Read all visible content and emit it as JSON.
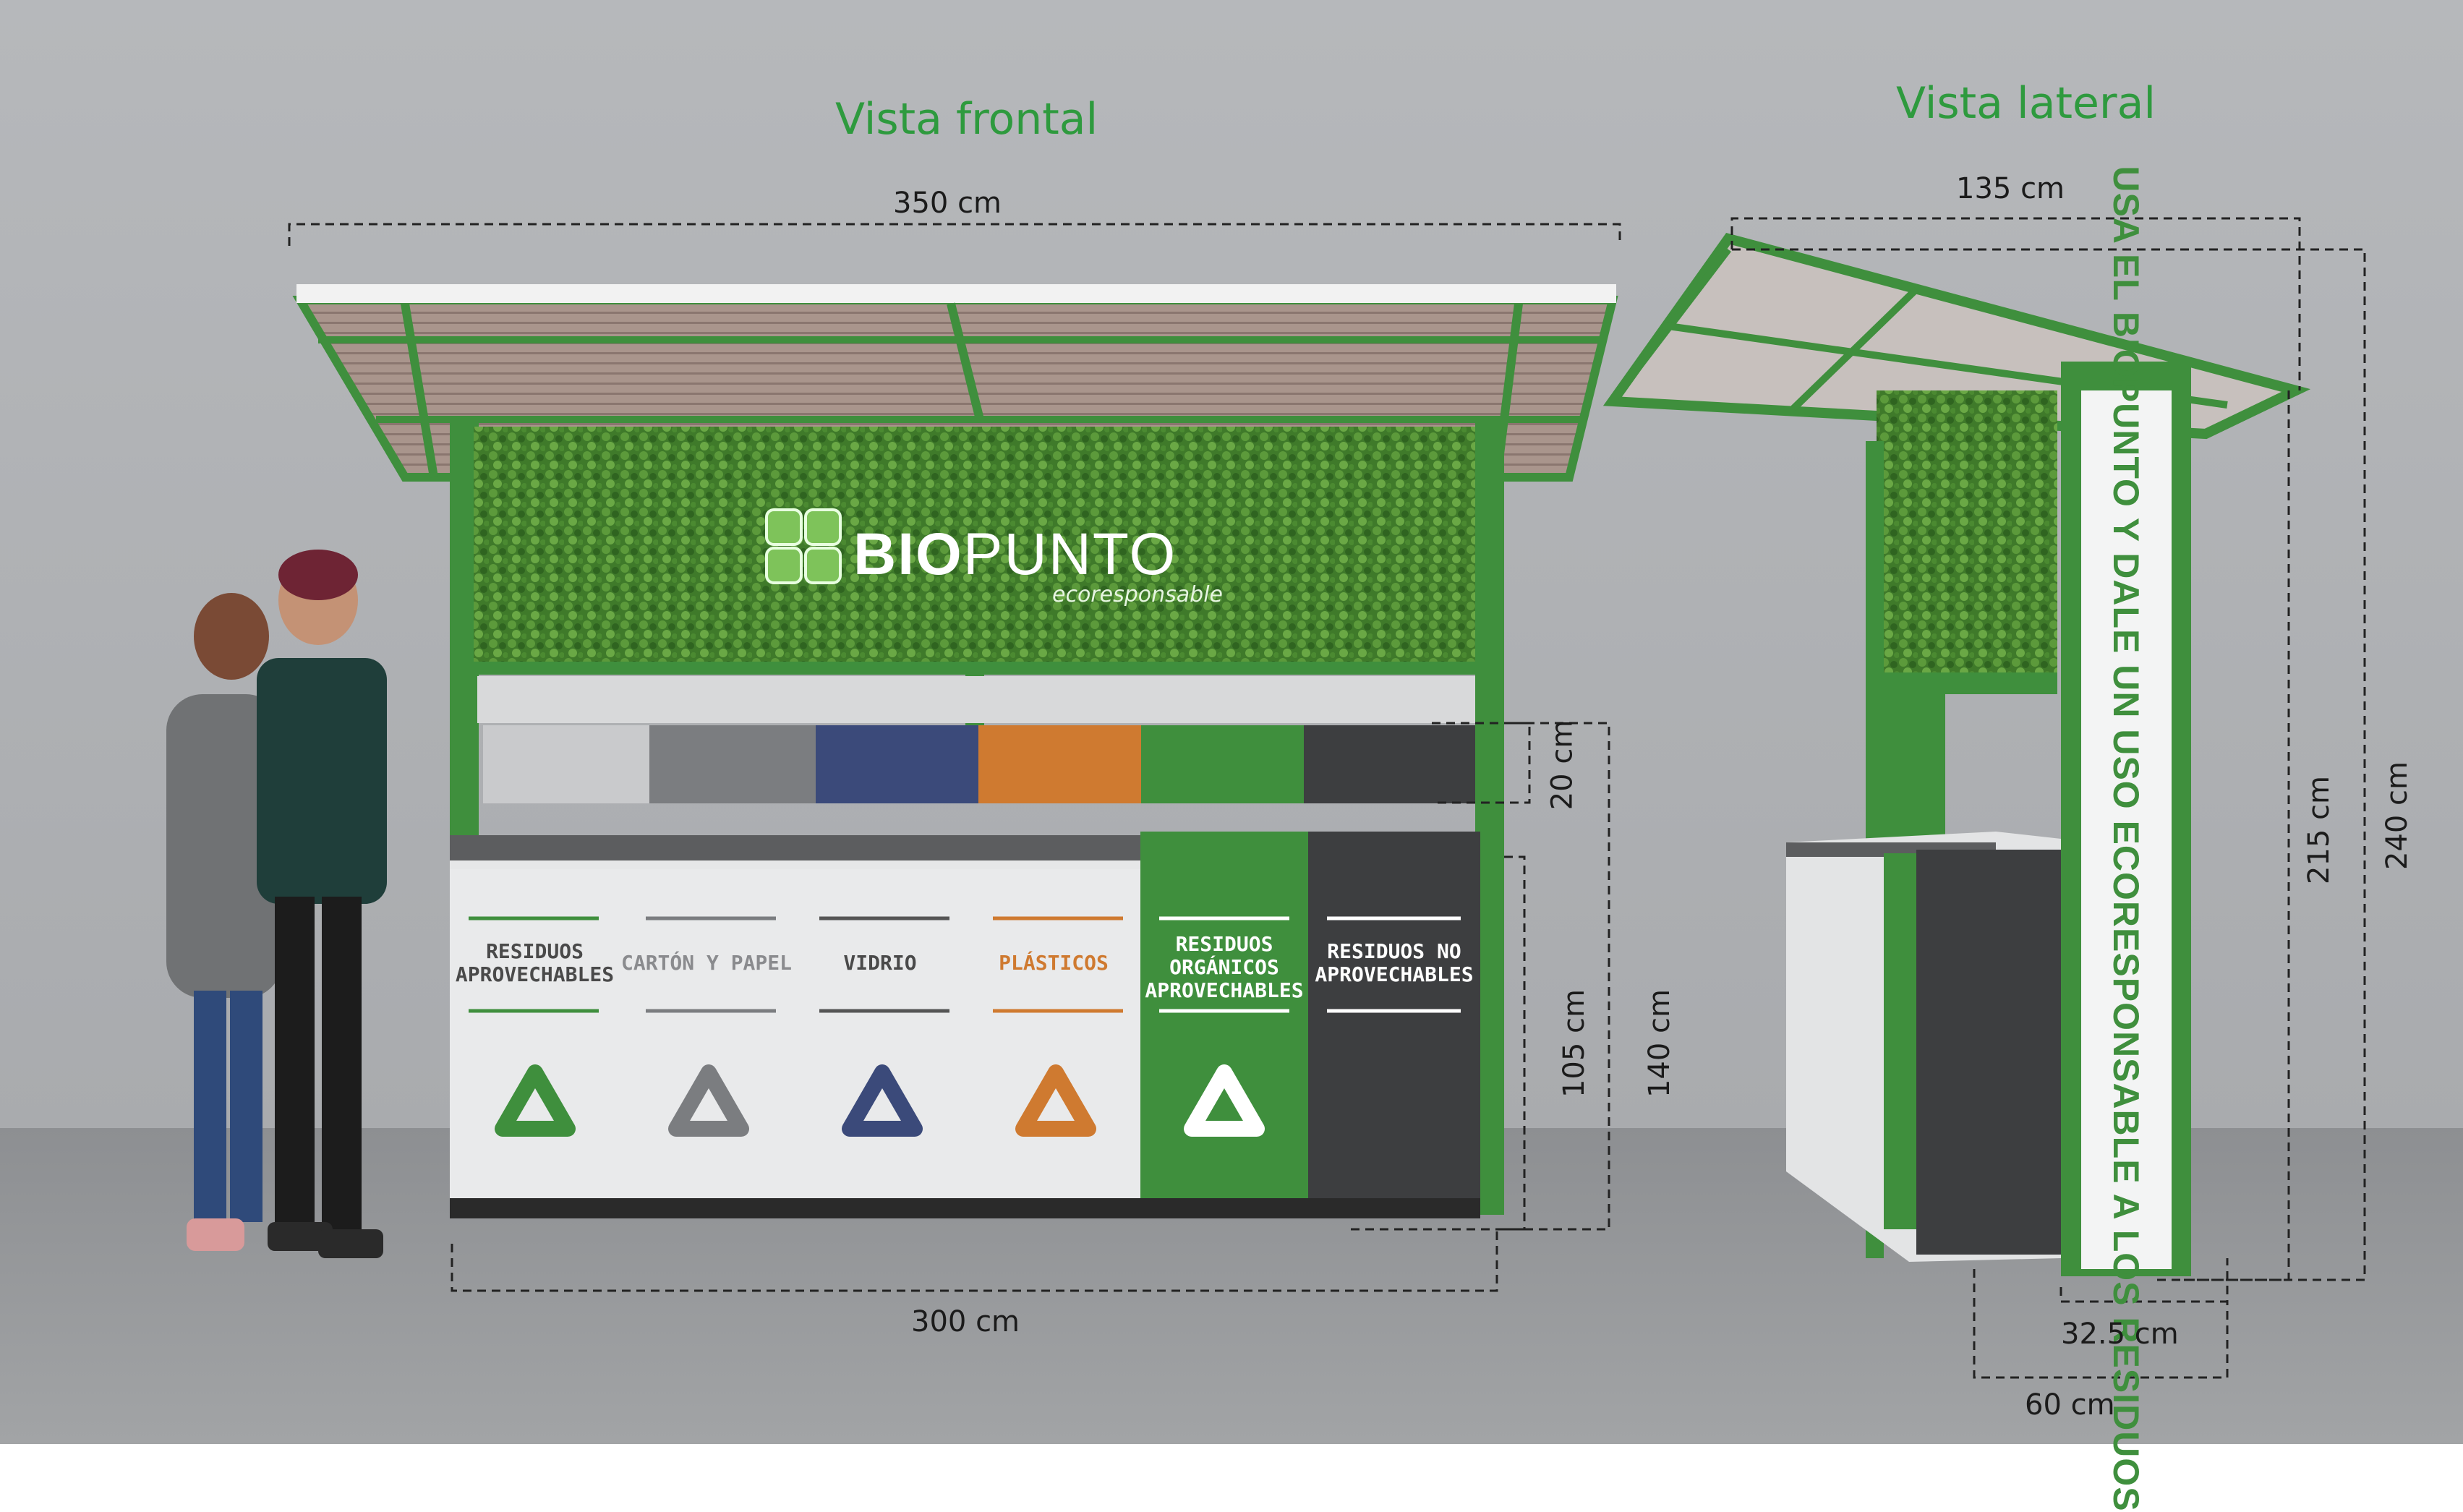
{
  "titles": {
    "front": "Vista frontal",
    "side": "Vista lateral"
  },
  "brand": {
    "name_bio": "BIO",
    "name_punto": "PUNTO",
    "tagline": "ecoresponsable"
  },
  "bins": [
    {
      "label": "RESIDUOS\nAPROVECHABLES",
      "color": "#3f8f3d",
      "icon": "recycle-icon"
    },
    {
      "label": "CARTÓN Y PAPEL",
      "color": "#7b7d80",
      "icon": "recycle-icon"
    },
    {
      "label": "VIDRIO",
      "color": "#3b4a7a",
      "icon": "recycle-icon"
    },
    {
      "label": "PLÁSTICOS",
      "color": "#cf7a30",
      "icon": "recycle-icon"
    },
    {
      "label": "RESIDUOS\nORGÁNICOS\nAPROVECHABLES",
      "color": "#ffffff",
      "icon": "recycle-icon"
    },
    {
      "label": "RESIDUOS NO\nAPROVECHABLES",
      "color": "#ffffff",
      "icon": "recycle-icon"
    }
  ],
  "side_banner": "USA EL BIOPUNTO Y DALE UN USO ECORESPONSABLE A LOS RESIDUOS",
  "dimensions": {
    "front_width_top": "350 cm",
    "front_width_bottom": "300 cm",
    "sign_height": "20 cm",
    "bin_height": "105 cm",
    "counter_height": "140 cm",
    "side_width_top": "135 cm",
    "side_height_inner": "215 cm",
    "side_height_total": "240 cm",
    "side_depth_small": "32.5 cm",
    "side_depth_base": "60 cm"
  },
  "colors": {
    "frame_green": "#3f8f3d",
    "brand_green": "#2e9a3e",
    "dark_bin": "#3d3e40"
  }
}
